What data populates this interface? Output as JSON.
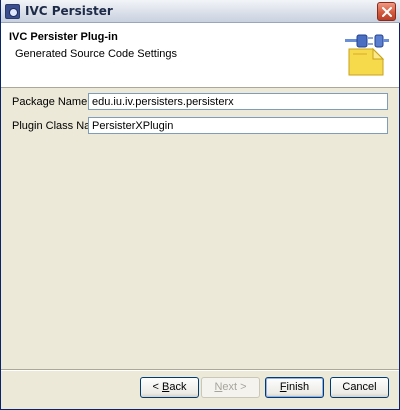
{
  "window": {
    "title": "IVC Persister"
  },
  "banner": {
    "title": "IVC Persister Plug-in",
    "description": "Generated Source Code Settings"
  },
  "form": {
    "package_name_label": "Package Name:",
    "package_name_value": "edu.iu.iv.persisters.persisterx",
    "plugin_class_label": "Plugin Class Name:",
    "plugin_class_value": "PersisterXPlugin"
  },
  "buttons": {
    "back": {
      "prefix": "< ",
      "mnemonic": "B",
      "rest": "ack"
    },
    "next": {
      "mnemonic": "N",
      "rest": "ext >"
    },
    "finish": {
      "mnemonic": "F",
      "rest": "inish"
    },
    "cancel": {
      "label": "Cancel"
    }
  },
  "icons": {
    "app": "app-icon",
    "close": "close-icon",
    "banner": "plugin-connector-icon"
  },
  "colors": {
    "title_bar": "#dfe4ec",
    "dialog_bg": "#ece9d8",
    "close_button": "#d25b3f",
    "input_border": "#7f9db9"
  }
}
